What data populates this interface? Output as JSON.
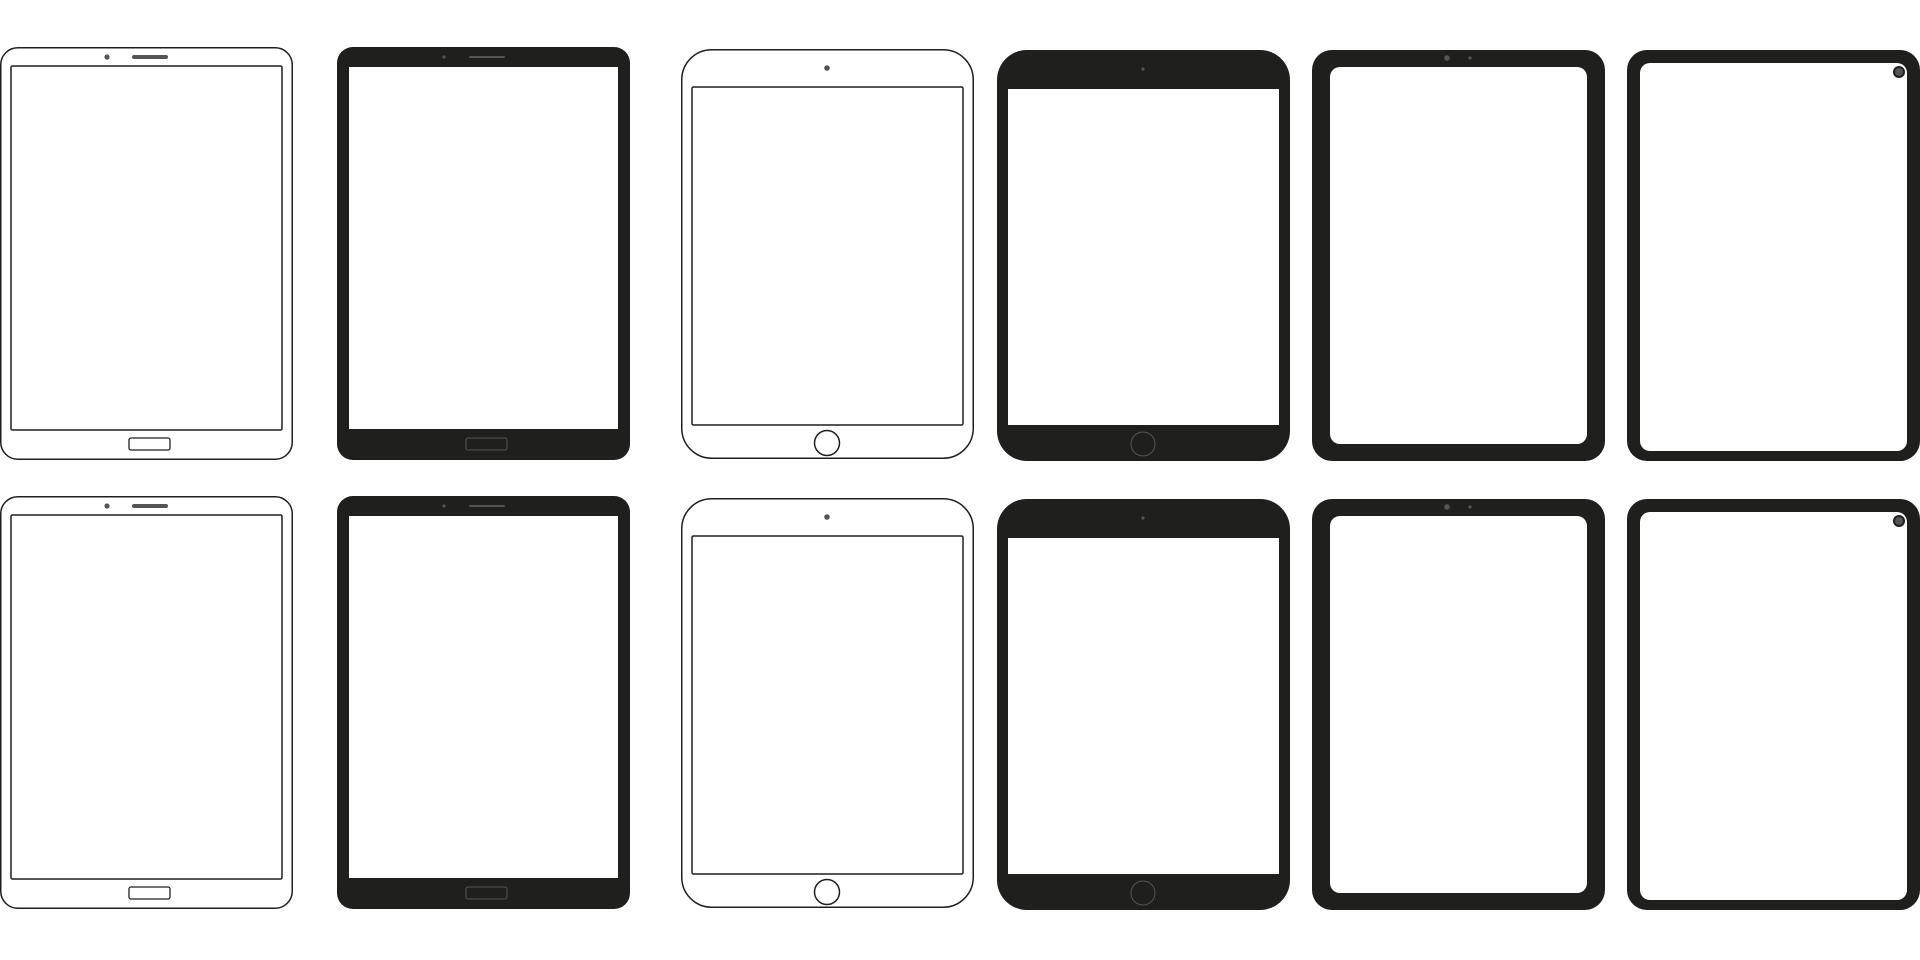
{
  "colors": {
    "background": "#ffffff",
    "device_dark": "#1f1f1d",
    "device_outline": "#1f1f1d",
    "screen": "#ffffff",
    "sensor_gray": "#555555"
  },
  "rows": [
    {
      "devices": [
        {
          "style": "outline-android-tablet",
          "icon": "tablet-outline-icon"
        },
        {
          "style": "dark-android-tablet",
          "icon": "tablet-dark-icon"
        },
        {
          "style": "outline-ipad-home-button",
          "icon": "ipad-outline-icon"
        },
        {
          "style": "dark-ipad-home-button",
          "icon": "ipad-dark-icon"
        },
        {
          "style": "dark-thin-bezel-tablet",
          "icon": "tablet-thin-bezel-icon"
        },
        {
          "style": "dark-punch-hole-tablet",
          "icon": "tablet-punch-hole-icon"
        }
      ]
    },
    {
      "devices": [
        {
          "style": "outline-android-tablet",
          "icon": "tablet-outline-icon"
        },
        {
          "style": "dark-android-tablet",
          "icon": "tablet-dark-icon"
        },
        {
          "style": "outline-ipad-home-button",
          "icon": "ipad-outline-icon"
        },
        {
          "style": "dark-ipad-home-button",
          "icon": "ipad-dark-icon"
        },
        {
          "style": "dark-thin-bezel-tablet",
          "icon": "tablet-thin-bezel-icon"
        },
        {
          "style": "dark-punch-hole-tablet",
          "icon": "tablet-punch-hole-icon"
        }
      ]
    }
  ]
}
